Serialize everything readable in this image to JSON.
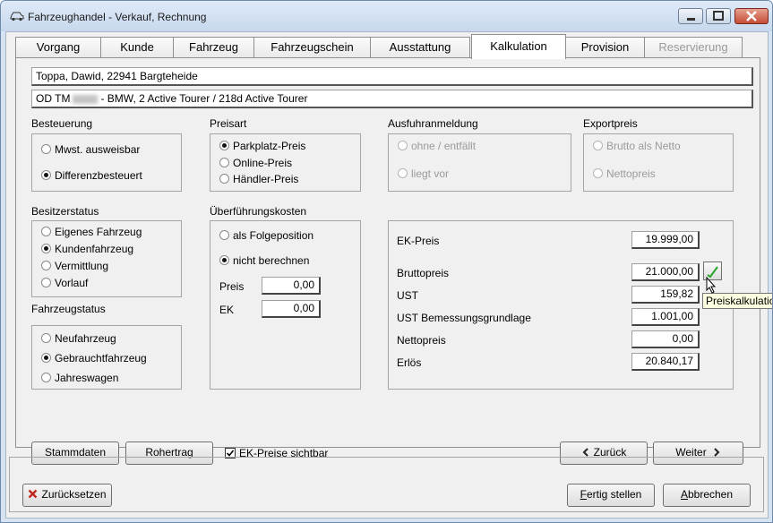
{
  "window": {
    "title": "Fahrzeughandel - Verkauf, Rechnung"
  },
  "tabs": [
    {
      "label": "Vorgang"
    },
    {
      "label": "Kunde"
    },
    {
      "label": "Fahrzeug"
    },
    {
      "label": "Fahrzeugschein"
    },
    {
      "label": "Ausstattung"
    },
    {
      "label": "Kalkulation"
    },
    {
      "label": "Provision"
    },
    {
      "label": "Reservierung"
    }
  ],
  "header": {
    "customer": "Toppa, Dawid, 22941 Bargteheide",
    "vehicle_prefix": "OD TM",
    "vehicle_rest": "- BMW, 2 Active Tourer / 218d Active Tourer"
  },
  "besteuerung": {
    "label": "Besteuerung",
    "options": [
      "Mwst. ausweisbar",
      "Differenzbesteuert"
    ],
    "selected": "Differenzbesteuert"
  },
  "preisart": {
    "label": "Preisart",
    "options": [
      "Parkplatz-Preis",
      "Online-Preis",
      "Händler-Preis"
    ],
    "selected": "Parkplatz-Preis"
  },
  "ausfuhr": {
    "label": "Ausfuhranmeldung",
    "options": [
      "ohne / entfällt",
      "liegt vor"
    ]
  },
  "exportpreis": {
    "label": "Exportpreis",
    "options": [
      "Brutto als Netto",
      "Nettopreis"
    ]
  },
  "besitzerstatus": {
    "label": "Besitzerstatus",
    "options": [
      "Eigenes Fahrzeug",
      "Kundenfahrzeug",
      "Vermittlung",
      "Vorlauf"
    ],
    "selected": "Kundenfahrzeug"
  },
  "fahrzeugstatus": {
    "label": "Fahrzeugstatus",
    "options": [
      "Neufahrzeug",
      "Gebrauchtfahrzeug",
      "Jahreswagen"
    ],
    "selected": "Gebrauchtfahrzeug"
  },
  "ueberfuehrung": {
    "label": "Überführungskosten",
    "options": [
      "als Folgeposition",
      "nicht berechnen"
    ],
    "selected": "nicht berechnen",
    "preis_label": "Preis",
    "preis_value": "0,00",
    "ek_label": "EK",
    "ek_value": "0,00"
  },
  "kalkulation": {
    "ek_label": "EK-Preis",
    "ek_value": "19.999,00",
    "brutto_label": "Bruttopreis",
    "brutto_value": "21.000,00",
    "ust_label": "UST",
    "ust_value": "159,82",
    "bemessung_label": "UST Bemessungsgrundlage",
    "bemessung_value": "1.001,00",
    "netto_label": "Nettopreis",
    "netto_value": "0,00",
    "erloes_label": "Erlös",
    "erloes_value": "20.840,17",
    "tooltip": "Preiskalkulation"
  },
  "buttons": {
    "stammdaten_a": "Stamm",
    "stammdaten_u": "d",
    "stammdaten_b": "aten",
    "rohertrag_u": "R",
    "rohertrag_b": "ohertrag",
    "ek_visible_label": "EK-Preise sichtbar",
    "zurueck_u": "Z",
    "zurueck_b": "urück",
    "weiter_u": "W",
    "weiter_b": "eiter",
    "reset_label": "Zurücksetzen",
    "fertig_u": "F",
    "fertig_b": "ertig stellen",
    "abbrechen_u": "A",
    "abbrechen_b": "bbrechen"
  },
  "colors": {
    "accent_check": "#2aa52a",
    "reset_x": "#c0281e"
  }
}
